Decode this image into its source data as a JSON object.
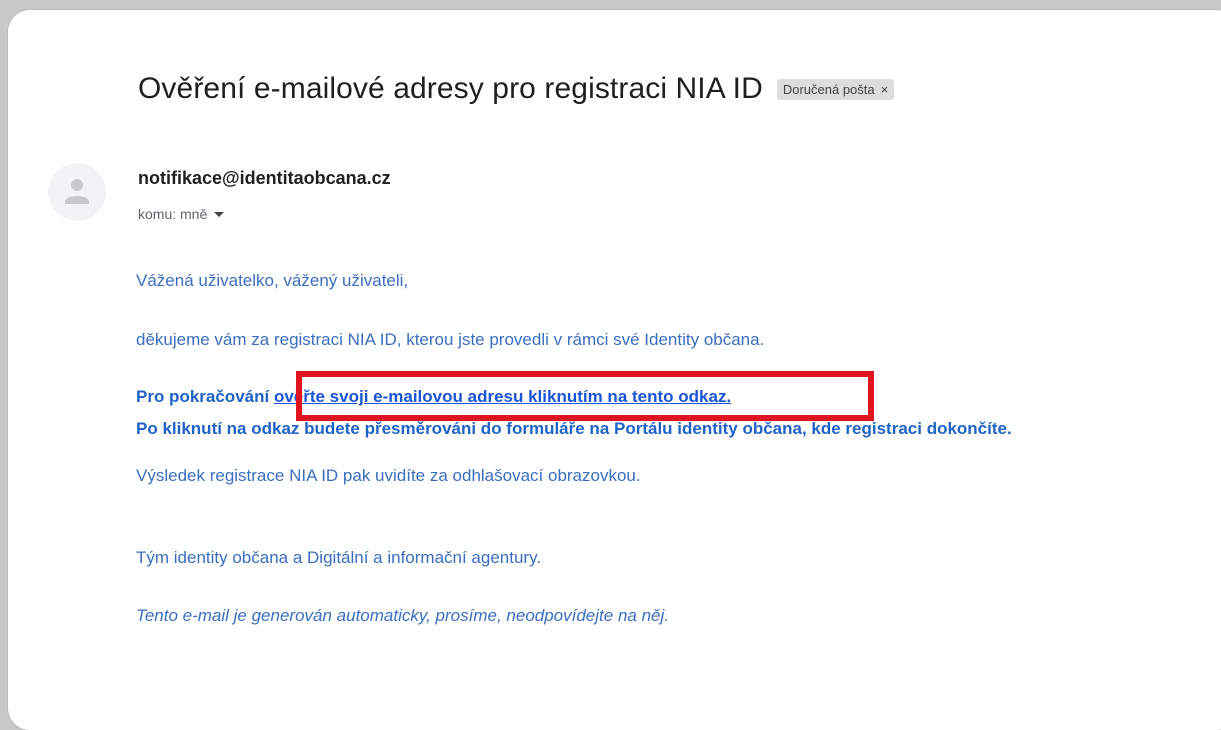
{
  "email": {
    "subject": "Ověření e-mailové adresy pro registraci NIA ID",
    "label": "Doručená pošta",
    "label_close": "×",
    "sender": "notifikace@identitaobcana.cz",
    "recipient": "komu: mně"
  },
  "body": {
    "greeting": "Vážená uživatelko, vážený uživateli,",
    "thanks": "děkujeme vám za registraci NIA ID, kterou jste provedli v rámci své Identity občana.",
    "continue_prefix": "Pro pokračování ",
    "verify_link": "ověřte svoji e-mailovou adresu kliknutím na tento odkaz.",
    "redirect_line": "Po kliknutí na odkaz budete přesměrováni do formuláře na Portálu identity občana, kde registraci dokončíte.",
    "result_line": "Výsledek registrace NIA ID pak uvidíte za odhlašovací obrazovkou.",
    "team_line": "Tým identity občana a Digitální a informační agentury.",
    "auto_note": "Tento e-mail je generován automaticky, prosíme, neodpovídejte na něj."
  },
  "icons": {
    "avatar": "person-icon",
    "dropdown": "caret-down-icon",
    "highlight": "red-highlight-box"
  },
  "colors": {
    "link": "#1a55d6",
    "body_text": "#3a6fbf",
    "highlight": "#e0141e"
  }
}
